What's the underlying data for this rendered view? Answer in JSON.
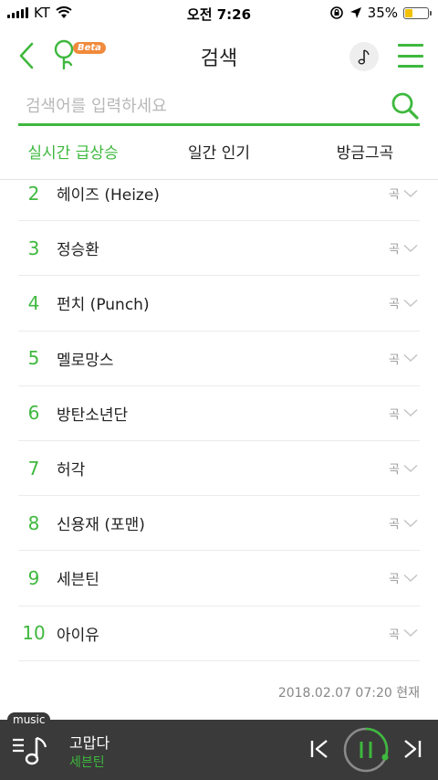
{
  "status_bar": {
    "carrier": "KT",
    "time": "오전 7:26",
    "battery_percent": "35%",
    "battery_level": 0.35,
    "icons": [
      "signal-icon",
      "wifi-icon",
      "orientation-lock-icon",
      "location-icon",
      "battery-icon"
    ]
  },
  "header": {
    "title": "검색",
    "beta_badge": "Beta",
    "icons": [
      "back-chevron-icon",
      "logo-icon",
      "music-note-icon",
      "hamburger-menu-icon"
    ]
  },
  "search": {
    "placeholder": "검색어를 입력하세요",
    "value": ""
  },
  "tabs": [
    {
      "label": "실시간 급상승",
      "active": true
    },
    {
      "label": "일간 인기",
      "active": false
    },
    {
      "label": "방금그곡",
      "active": false
    }
  ],
  "chart": {
    "items": [
      {
        "rank": "2",
        "artist": "헤이즈 (Heize)",
        "type": "곡"
      },
      {
        "rank": "3",
        "artist": "정승환",
        "type": "곡"
      },
      {
        "rank": "4",
        "artist": "펀치 (Punch)",
        "type": "곡"
      },
      {
        "rank": "5",
        "artist": "멜로망스",
        "type": "곡"
      },
      {
        "rank": "6",
        "artist": "방탄소년단",
        "type": "곡"
      },
      {
        "rank": "7",
        "artist": "허각",
        "type": "곡"
      },
      {
        "rank": "8",
        "artist": "신용재 (포맨)",
        "type": "곡"
      },
      {
        "rank": "9",
        "artist": "세븐틴",
        "type": "곡"
      },
      {
        "rank": "10",
        "artist": "아이유",
        "type": "곡"
      }
    ],
    "timestamp": "2018.02.07 07:20 현재"
  },
  "player": {
    "label": "music",
    "song_title": "고맙다",
    "artist": "세븐틴",
    "state": "playing",
    "icons": [
      "playlist-icon",
      "previous-icon",
      "pause-icon",
      "next-icon"
    ]
  },
  "colors": {
    "accent": "#3eb83e",
    "player_background": "#3a3a3a",
    "beta_badge": "#f08a3c",
    "battery": "#f2c100"
  }
}
